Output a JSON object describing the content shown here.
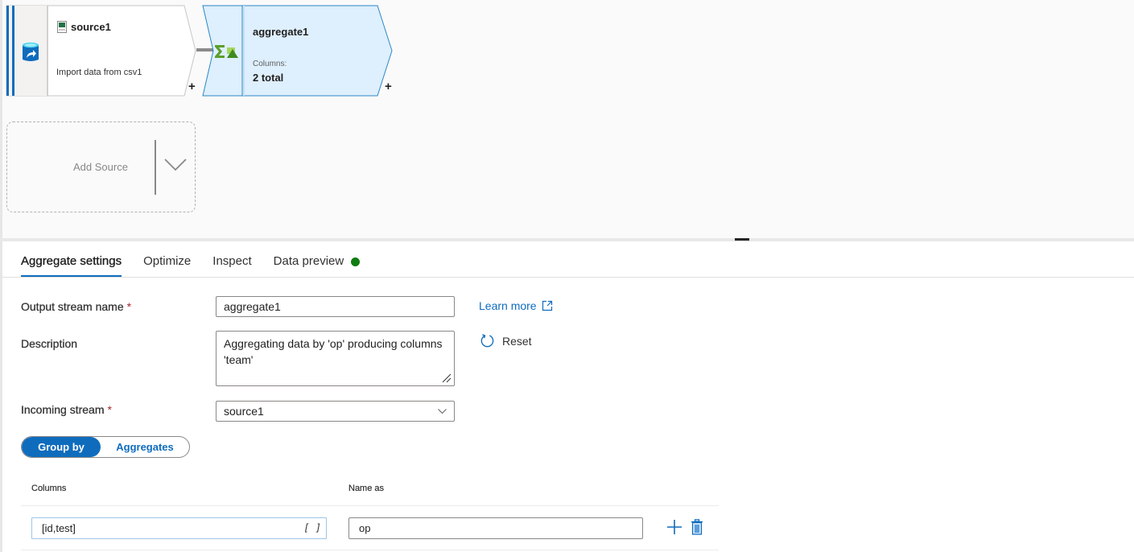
{
  "canvas": {
    "source_node": {
      "title": "source1",
      "description": "Import data from csv1",
      "icon": "database-icon",
      "file_icon": "csv-file-icon",
      "add_label": "+"
    },
    "aggregate_node": {
      "title": "aggregate1",
      "columns_label": "Columns:",
      "columns_value": "2 total",
      "icon": "aggregate-sigma-icon",
      "add_label": "+"
    },
    "add_source": {
      "label": "Add Source"
    }
  },
  "tabs": [
    {
      "label": "Aggregate settings",
      "active": true
    },
    {
      "label": "Optimize",
      "active": false
    },
    {
      "label": "Inspect",
      "active": false
    },
    {
      "label": "Data preview",
      "active": false,
      "status": "ready"
    }
  ],
  "form": {
    "output_stream": {
      "label": "Output stream name",
      "required": "*",
      "value": "aggregate1"
    },
    "description": {
      "label": "Description",
      "value": "Aggregating data by 'op' producing columns 'team'"
    },
    "incoming_stream": {
      "label": "Incoming stream",
      "required": "*",
      "value": "source1"
    },
    "learn_more": "Learn more",
    "reset": "Reset"
  },
  "mode_toggle": {
    "options": [
      "Group by",
      "Aggregates"
    ],
    "selected": "Group by"
  },
  "group_by": {
    "headers": {
      "columns": "Columns",
      "name_as": "Name as"
    },
    "rows": [
      {
        "columns": "[id,test]",
        "expression_icon": "[ ]",
        "name_as": "op"
      }
    ]
  },
  "colors": {
    "accent": "#0f6cbd",
    "status_green": "#107c10",
    "required": "#a4262c",
    "aggregate_node_fill": "#deeffe"
  }
}
